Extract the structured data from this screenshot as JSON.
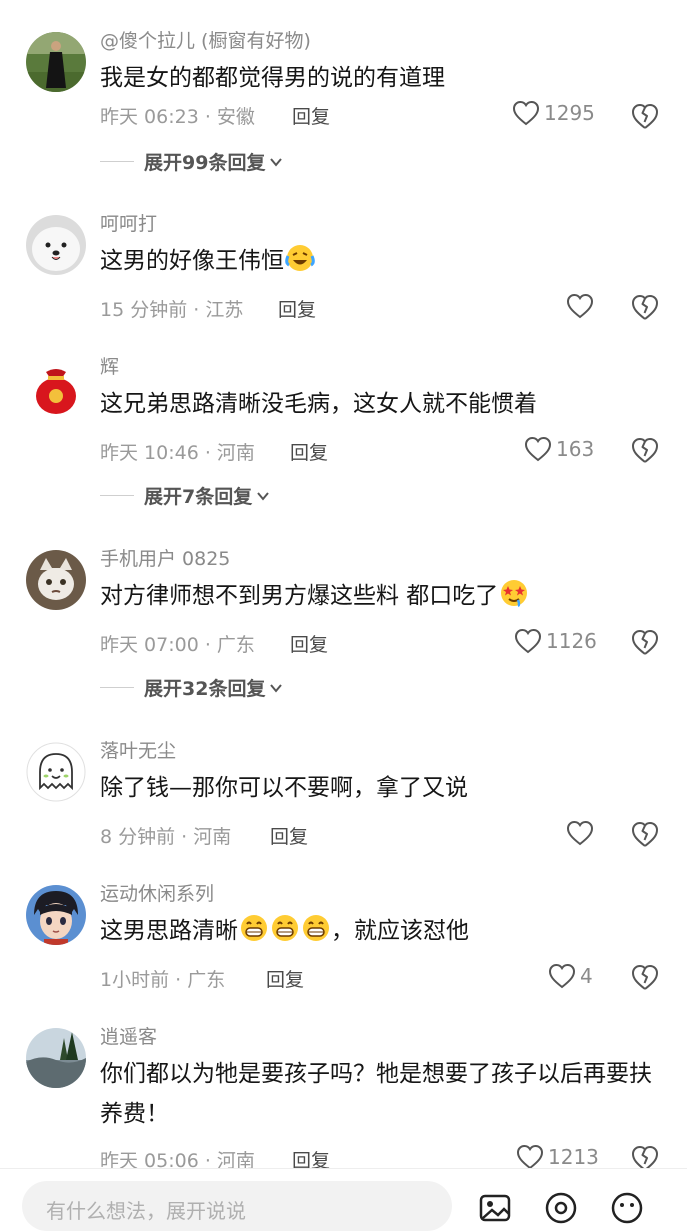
{
  "top_partial_title": "",
  "comments": [
    {
      "username": "@傻个拉儿 (橱窗有好物)",
      "text": "我是女的都都觉得男的说的有道理",
      "time": "昨天 06:23",
      "location": "安徽",
      "reply_label": "回复",
      "likes": "1295",
      "expand_label": "展开99条回复",
      "avatar": "woman-in-black-dress-on-grass-avatar"
    },
    {
      "username": "呵呵打",
      "text": "这男的好像王伟恒",
      "emoji": [
        "laughing-crying-emoji"
      ],
      "time": "15 分钟前",
      "location": "江苏",
      "reply_label": "回复",
      "likes": "",
      "avatar": "white-samoyed-dog-avatar"
    },
    {
      "username": "辉",
      "text": "这兄弟思路清晰没毛病，这女人就不能惯着",
      "time": "昨天 10:46",
      "location": "河南",
      "reply_label": "回复",
      "likes": "163",
      "expand_label": "展开7条回复",
      "avatar": "red-lucky-bag-avatar"
    },
    {
      "username": "手机用户 0825",
      "text": "对方律师想不到男方爆这些料 都口吃了",
      "emoji": [
        "drooling-starry-eyes-emoji"
      ],
      "time": "昨天 07:00",
      "location": "广东",
      "reply_label": "回复",
      "likes": "1126",
      "expand_label": "展开32条回复",
      "avatar": "cat-avatar"
    },
    {
      "username": "落叶无尘",
      "text": "除了钱—那你可以不要啊，拿了又说",
      "time": "8 分钟前",
      "location": "河南",
      "reply_label": "回复",
      "likes": "",
      "avatar": "cartoon-ghost-avatar"
    },
    {
      "username": "运动休闲系列",
      "text": "这男思路清晰",
      "text_after_emoji": "，就应该怼他",
      "emoji": [
        "grinning-emoji",
        "grinning-emoji",
        "grinning-emoji"
      ],
      "time": "1小时前",
      "location": "广东",
      "reply_label": "回复",
      "likes": "4",
      "avatar": "anime-boy-avatar"
    },
    {
      "username": "逍遥客",
      "text": "你们都以为牠是要孩子吗？牠是想要了孩子以后再要扶养费！",
      "time": "昨天 05:06",
      "location": "河南",
      "reply_label": "回复",
      "likes": "1213",
      "avatar": "landscape-avatar"
    }
  ],
  "bottom_bar": {
    "placeholder": "有什么想法，展开说说",
    "icons": [
      "image-icon",
      "at-icon",
      "emoji-icon"
    ]
  },
  "colors": {
    "meta_gray": "#9a9a9a",
    "username_gray": "#8a8a8a",
    "text_dark": "#161616"
  }
}
